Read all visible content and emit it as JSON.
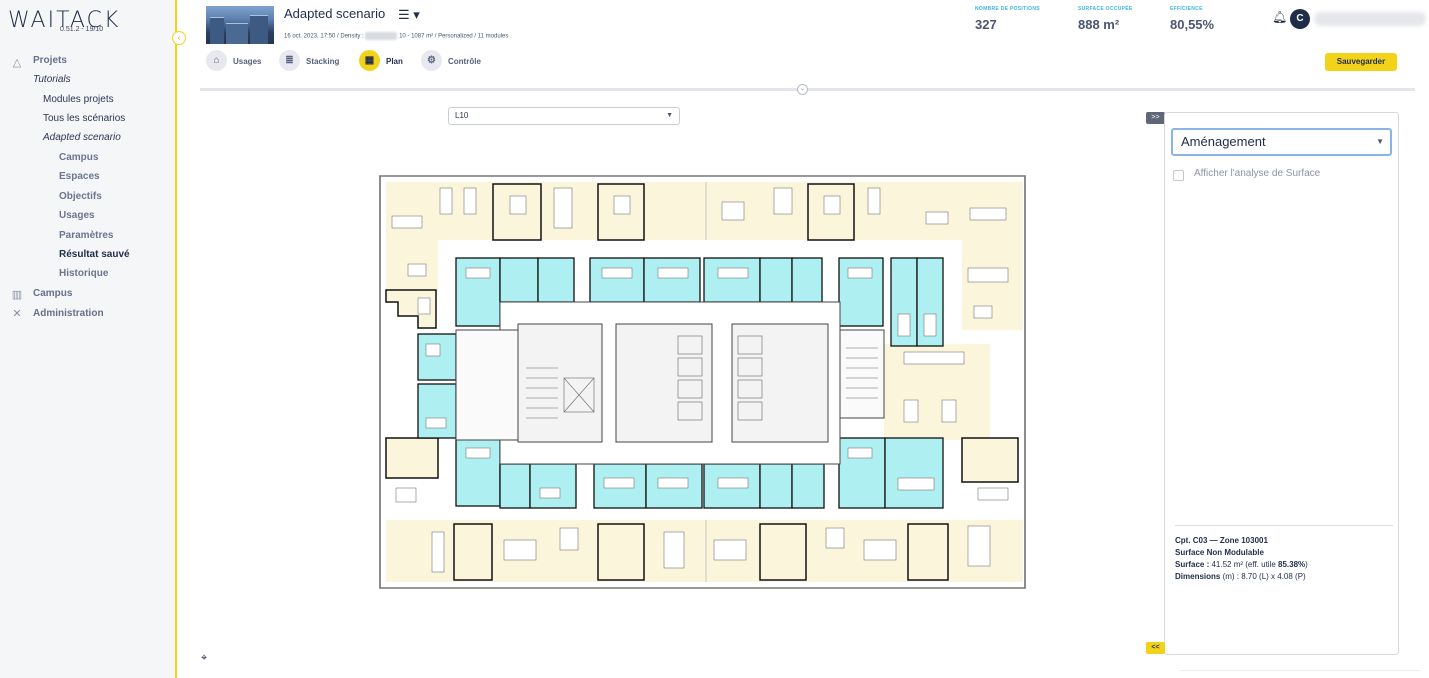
{
  "app": {
    "logo": "WAITACK",
    "version": "0.51.2 - 19/10"
  },
  "sidebar": {
    "items": [
      {
        "label": "Projets",
        "icon": "projects-icon"
      },
      {
        "label": "Tutorials"
      },
      {
        "label": "Modules projets"
      },
      {
        "label": "Tous les scénarios"
      },
      {
        "label": "Adapted scenario"
      },
      {
        "label": "Campus"
      },
      {
        "label": "Espaces"
      },
      {
        "label": "Objectifs"
      },
      {
        "label": "Usages"
      },
      {
        "label": "Paramètres"
      },
      {
        "label": "Résultat sauvé"
      },
      {
        "label": "Historique"
      },
      {
        "label": "Campus",
        "icon": "campus-icon"
      },
      {
        "label": "Administration",
        "icon": "tools-icon"
      }
    ]
  },
  "header": {
    "scenario_title": "Adapted scenario",
    "meta_prefix": "16 oct. 2023, 17:50 / Density :",
    "meta_suffix": "10 - 1087 m² / Personalized / 11 modules",
    "tabs": [
      {
        "label": "Usages",
        "icon": "sofa-icon"
      },
      {
        "label": "Stacking",
        "icon": "stack-icon"
      },
      {
        "label": "Plan",
        "icon": "plan-icon",
        "active": true
      },
      {
        "label": "Contrôle",
        "icon": "gear-icon"
      }
    ],
    "kpis": [
      {
        "key": "NOMBRE DE POSITIONS",
        "value": "327"
      },
      {
        "key": "SURFACE OCCUPÉE",
        "value": "888 m²"
      },
      {
        "key": "EFFICIENCE",
        "value": "80,55%"
      }
    ],
    "avatar_initial": "C",
    "save_label": "Sauvegarder"
  },
  "plan": {
    "level": "L10"
  },
  "panel": {
    "toggle_top": ">>",
    "toggle_bottom": "<<",
    "mode": "Aménagement",
    "checkbox_label": "Afficher l'analyse de Surface",
    "info": {
      "title": "Cpt. C03 — Zone 103001",
      "subtitle": "Surface Non Modulable",
      "surface_label": "Surface :",
      "surface_value": "41.52 m² (eff. utile",
      "surface_eff": "85.38%",
      "surface_close": ")",
      "dims_label": "Dimensions",
      "dims_value": "(m) : 8.70 (L) x 4.08 (P)"
    }
  },
  "colors": {
    "accent": "#f3d21a",
    "navy": "#1f2d4a",
    "meeting_room": "#aef0f2",
    "open_space": "#fbf5dc",
    "kpi_label": "#3fb3e0"
  }
}
